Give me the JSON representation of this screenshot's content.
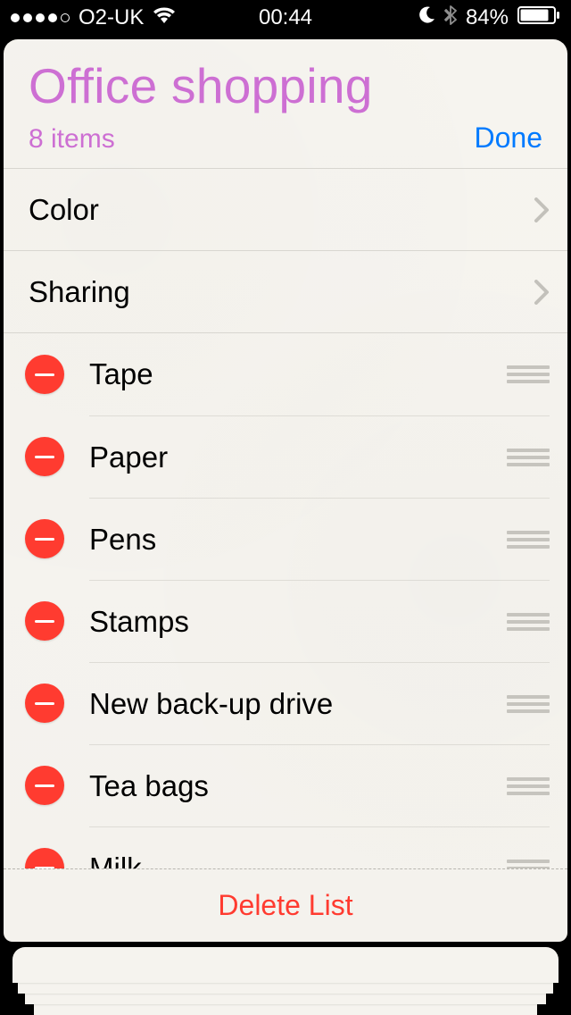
{
  "statusbar": {
    "carrier": "O2-UK",
    "time": "00:44",
    "battery": "84%"
  },
  "header": {
    "title": "Office shopping",
    "count": "8 items",
    "done": "Done"
  },
  "sections": {
    "color": "Color",
    "sharing": "Sharing"
  },
  "items": [
    {
      "label": "Tape"
    },
    {
      "label": "Paper"
    },
    {
      "label": "Pens"
    },
    {
      "label": "Stamps"
    },
    {
      "label": "New back-up drive"
    },
    {
      "label": "Tea bags"
    },
    {
      "label": "Milk"
    }
  ],
  "footer": {
    "delete": "Delete List"
  },
  "colors": {
    "accent": "#cd6fd3",
    "blue": "#007aff",
    "red": "#ff3b30"
  }
}
